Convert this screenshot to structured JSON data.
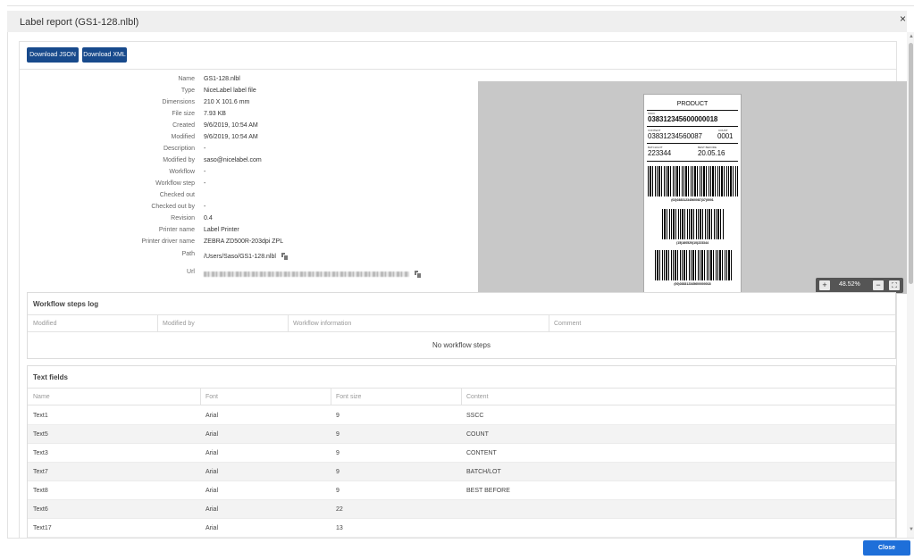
{
  "dialog": {
    "title": "Label report (GS1-128.nlbl)",
    "close_icon": "×"
  },
  "toolbar": {
    "json_label": "Download JSON",
    "xml_label": "Download XML"
  },
  "properties": [
    {
      "label": "Name",
      "value": "GS1-128.nlbl"
    },
    {
      "label": "Type",
      "value": "NiceLabel label file"
    },
    {
      "label": "Dimensions",
      "value": "210 X 101.6 mm"
    },
    {
      "label": "File size",
      "value": "7.93 KB"
    },
    {
      "label": "Created",
      "value": "9/6/2019, 10:54 AM"
    },
    {
      "label": "Modified",
      "value": "9/6/2019, 10:54 AM"
    },
    {
      "label": "Description",
      "value": "-"
    },
    {
      "label": "Modified by",
      "value": "saso@nicelabel.com"
    },
    {
      "label": "Workflow",
      "value": "-"
    },
    {
      "label": "Workflow step",
      "value": "-"
    },
    {
      "label": "Checked out",
      "value": ""
    },
    {
      "label": "Checked out by",
      "value": "-"
    },
    {
      "label": "Revision",
      "value": "0.4"
    },
    {
      "label": "Printer name",
      "value": "Label Printer"
    },
    {
      "label": "Printer driver name",
      "value": "ZEBRA ZD500R-203dpi ZPL"
    },
    {
      "label": "Path",
      "value": "/Users/Saso/GS1-128.nlbl"
    },
    {
      "label": "Url",
      "value": ""
    }
  ],
  "preview": {
    "label_title": "PRODUCT",
    "sscc_caption": "SSCC",
    "sscc_value": "038312345600000018",
    "content_caption": "CONTENT",
    "content_value": "03831234560087",
    "count_caption": "COUNT",
    "count_value": "0001",
    "batch_caption": "BATCH/LOT",
    "batch_value": "223344",
    "best_before_caption": "BEST BEFORE",
    "best_before_value": "20.05.16",
    "barcode1_text": "(02)03831234560087(37)0001",
    "barcode2_text": "(15)160520(10)223344",
    "barcode3_text": "(00)038312345600000018",
    "zoom": "48.52%",
    "zoom_in": "+",
    "zoom_out": "−",
    "fit": "⛶"
  },
  "workflow_log": {
    "title": "Workflow steps log",
    "columns": [
      "Modified",
      "Modified by",
      "Workflow information",
      "Comment"
    ],
    "empty_message": "No workflow steps"
  },
  "text_fields": {
    "title": "Text fields",
    "columns": [
      "Name",
      "Font",
      "Font size",
      "Content"
    ],
    "rows": [
      [
        "Text1",
        "Arial",
        "9",
        "SSCC"
      ],
      [
        "Text5",
        "Arial",
        "9",
        "COUNT"
      ],
      [
        "Text3",
        "Arial",
        "9",
        "CONTENT"
      ],
      [
        "Text7",
        "Arial",
        "9",
        "BATCH/LOT"
      ],
      [
        "Text8",
        "Arial",
        "9",
        "BEST BEFORE"
      ],
      [
        "Text6",
        "Arial",
        "22",
        ""
      ],
      [
        "Text17",
        "Arial",
        "13",
        ""
      ]
    ]
  },
  "footer": {
    "close_label": "Close"
  }
}
